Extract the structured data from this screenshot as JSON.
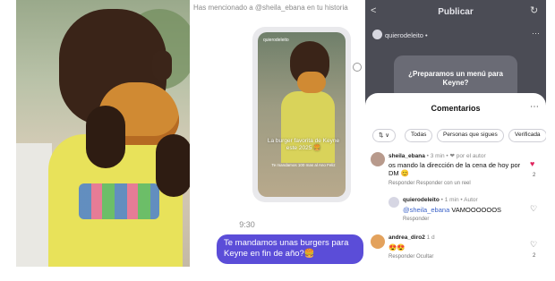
{
  "dm": {
    "story_note": "Has mencionado a @sheila_ebana en tu historia",
    "story_user": "quierodeleito",
    "story_text_1": "La burger favorita de Keyne este 2025 🍔",
    "story_text_2": "Te mandamos 100 mas al Ano Feliz",
    "timestamp": "9:30",
    "message": "Te mandamos unas burgers para Keyne en fin de año?🍔"
  },
  "ig": {
    "header_title": "Publicar",
    "back_glyph": "<",
    "sync_glyph": "↻",
    "account": "quierodeleito •",
    "promo_text": "¿Preparamos un menú para Keyne?",
    "sheet_title": "Comentarios",
    "more_glyph": "⋯",
    "chips": [
      "⇅ ∨",
      "Todas",
      "Personas que sigues",
      "Verificada"
    ],
    "comments": [
      {
        "user": "sheila_ebana",
        "meta": "• 3 min • ❤ por el autor",
        "text": "os mando la dirección de la cena de hoy por DM 😊",
        "actions": "Responder    Responder con un reel",
        "likes": "2",
        "liked": true
      },
      {
        "user": "quierodeleito",
        "meta": "• 1 min • Autor",
        "mention": "@sheila_ebana",
        "text": " VAMOOOOOOS",
        "actions": "Responder",
        "likes": "",
        "liked": false
      },
      {
        "user": "andrea_diro2",
        "meta": "1 d",
        "text": "😍😍",
        "actions": "Responder    Ocultar",
        "likes": "2",
        "liked": false
      }
    ],
    "colors": {
      "accent": "#5b4dd8",
      "heart_liked": "#e0245e"
    }
  }
}
